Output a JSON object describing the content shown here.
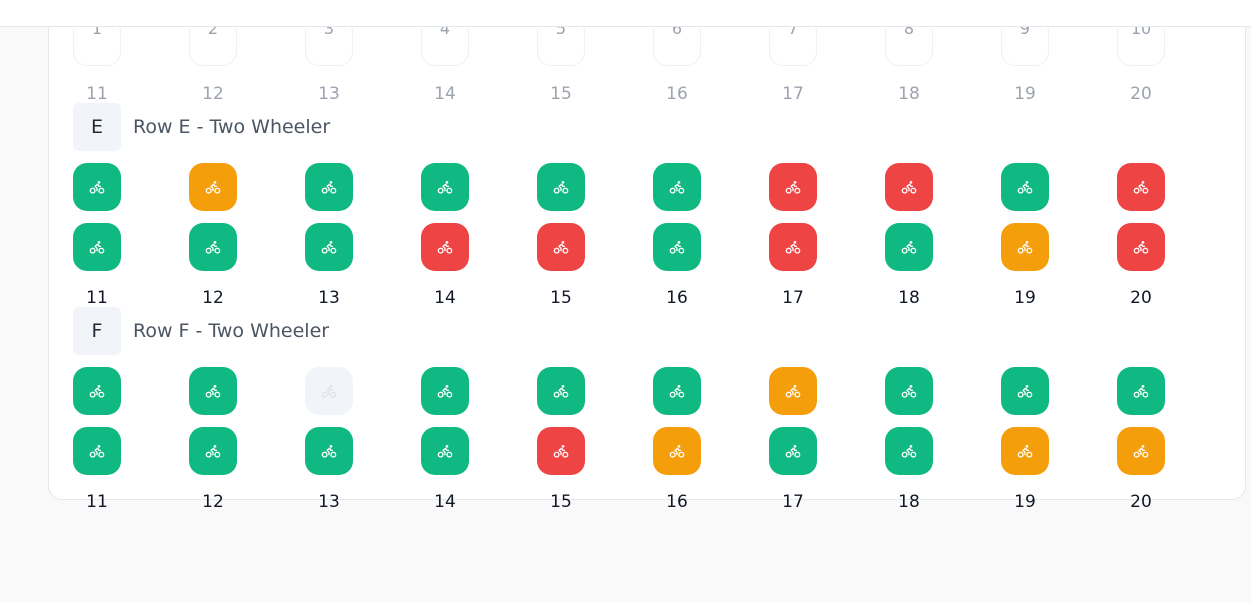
{
  "colors": {
    "available": "#10b981",
    "reserved": "#f59e0b",
    "occupied": "#ef4444",
    "disabled": "#f1f4f8"
  },
  "slot_icon": "bike-icon",
  "top_partial": {
    "slot_numbers": [
      "1",
      "2",
      "3",
      "4",
      "5",
      "6",
      "7",
      "8",
      "9",
      "10"
    ],
    "numbers": [
      "11",
      "12",
      "13",
      "14",
      "15",
      "16",
      "17",
      "18",
      "19",
      "20"
    ]
  },
  "rows": [
    {
      "letter": "E",
      "title": "Row E - Two Wheeler",
      "line1": [
        "available",
        "reserved",
        "available",
        "available",
        "available",
        "available",
        "occupied",
        "occupied",
        "available",
        "occupied"
      ],
      "line2": [
        "available",
        "available",
        "available",
        "occupied",
        "occupied",
        "available",
        "occupied",
        "available",
        "reserved",
        "occupied"
      ],
      "numbers": [
        "11",
        "12",
        "13",
        "14",
        "15",
        "16",
        "17",
        "18",
        "19",
        "20"
      ]
    },
    {
      "letter": "F",
      "title": "Row F - Two Wheeler",
      "line1": [
        "available",
        "available",
        "disabled",
        "available",
        "available",
        "available",
        "reserved",
        "available",
        "available",
        "available"
      ],
      "line2": [
        "available",
        "available",
        "available",
        "available",
        "occupied",
        "reserved",
        "available",
        "available",
        "reserved",
        "reserved"
      ],
      "numbers": [
        "11",
        "12",
        "13",
        "14",
        "15",
        "16",
        "17",
        "18",
        "19",
        "20"
      ]
    }
  ]
}
